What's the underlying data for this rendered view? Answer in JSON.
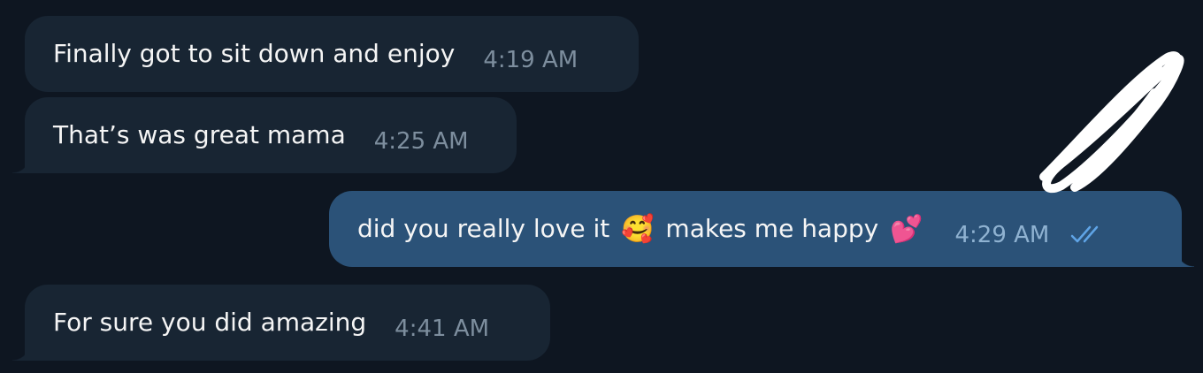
{
  "messages": [
    {
      "text": "Finally got to sit down and enjoy",
      "time": "4:19 AM"
    },
    {
      "text": "That’s was great mama",
      "time": "4:25 AM"
    },
    {
      "text_before": "did you really love it",
      "emoji1": "🥰",
      "text_middle": "makes me happy",
      "emoji2": "💕",
      "time": "4:29 AM",
      "status_icon": "double-check-icon"
    },
    {
      "text": "For sure you did amazing",
      "time": "4:41 AM"
    }
  ],
  "colors": {
    "background": "#0e1621",
    "incoming_bubble": "#182533",
    "outgoing_bubble": "#2b5278",
    "timestamp_incoming": "#7d8e9e",
    "timestamp_outgoing": "#8fb2d1",
    "read_ticks": "#5fa4e6",
    "scribble": "#ffffff"
  }
}
